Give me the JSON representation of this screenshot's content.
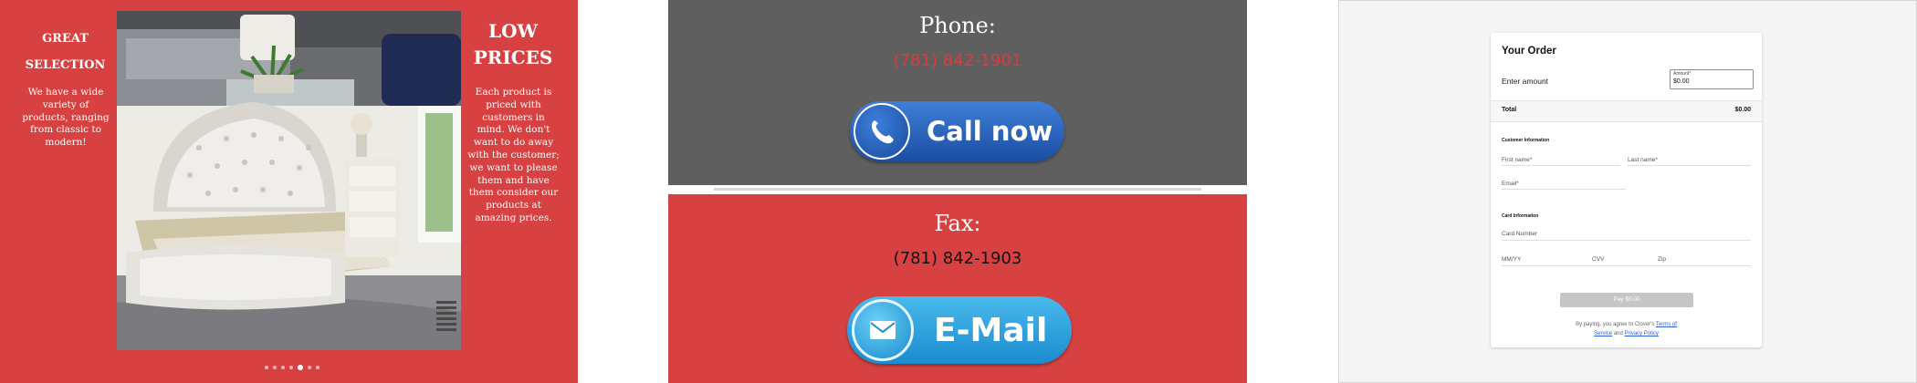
{
  "panel1": {
    "left_heading": [
      "GREAT",
      "SELECTION"
    ],
    "left_text": [
      "We have a wide",
      "variety of",
      "products, ranging",
      "from classic to",
      "modern!"
    ],
    "right_heading": [
      "LOW",
      "PRICES"
    ],
    "right_text": [
      "Each product is",
      "priced with",
      "customers in",
      "mind. We don't",
      "want to do away",
      "with the customer;",
      "we want to please",
      "them and have",
      "them consider our",
      "products at",
      "amazing prices."
    ],
    "carousel_dots": 7,
    "carousel_active_index": 4,
    "colors": {
      "background": "#d74141",
      "text": "#ffffff"
    }
  },
  "panel2": {
    "phone_label": "Phone:",
    "phone_number": "(781) 842-1901",
    "call_button": "Call now",
    "fax_label": "Fax:",
    "fax_number": "(781) 842-1903",
    "email_button": "E-Mail",
    "colors": {
      "top_background": "#5f5f5f",
      "bottom_background": "#d74141",
      "phone_number": "#e03a3a",
      "button_blue": "#1e58ad",
      "email_blue": "#1f9bd6"
    }
  },
  "panel3": {
    "title": "Your Order",
    "enter_amount": "Enter amount",
    "amount_label": "Amount*",
    "amount_value": "$0.00",
    "total_label": "Total",
    "total_value": "$0.00",
    "customer_info_heading": "Customer Information",
    "first_name": "First name*",
    "last_name": "Last name*",
    "email": "Email*",
    "card_info_heading": "Card Information",
    "card_number": "Card Number",
    "mmyy": "MM/YY",
    "cvv": "CVV",
    "zip": "Zip",
    "pay_button": "Pay $0.00",
    "terms_prefix": "By paying, you agree to Clover's",
    "terms_link1": "Terms of",
    "terms_link2": "Service",
    "terms_and": "and",
    "privacy_link": "Privacy Policy",
    "colors": {
      "link": "#2f5fd0",
      "pay_button": "#c6c6c6"
    }
  }
}
